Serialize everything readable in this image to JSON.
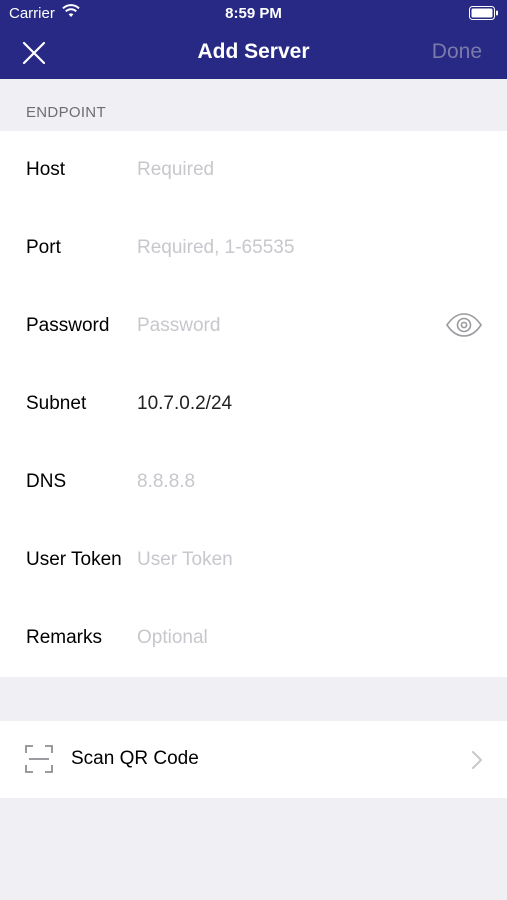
{
  "status_bar": {
    "carrier": "Carrier",
    "time": "8:59 PM"
  },
  "navbar": {
    "title": "Add Server",
    "done_label": "Done",
    "close_icon": "close-icon",
    "background": "#272985"
  },
  "section": {
    "header": "ENDPOINT"
  },
  "form": {
    "host": {
      "label": "Host",
      "value": "",
      "placeholder": "Required"
    },
    "port": {
      "label": "Port",
      "value": "",
      "placeholder": "Required, 1-65535"
    },
    "password": {
      "label": "Password",
      "value": "",
      "placeholder": "Password",
      "icon": "eye-icon"
    },
    "subnet": {
      "label": "Subnet",
      "value": "10.7.0.2/24",
      "placeholder": ""
    },
    "dns": {
      "label": "DNS",
      "value": "",
      "placeholder": "8.8.8.8"
    },
    "user_token": {
      "label": "User Token",
      "value": "",
      "placeholder": "User Token"
    },
    "remarks": {
      "label": "Remarks",
      "value": "",
      "placeholder": "Optional"
    }
  },
  "scan": {
    "label": "Scan QR Code",
    "icon": "qr-scan-icon"
  }
}
